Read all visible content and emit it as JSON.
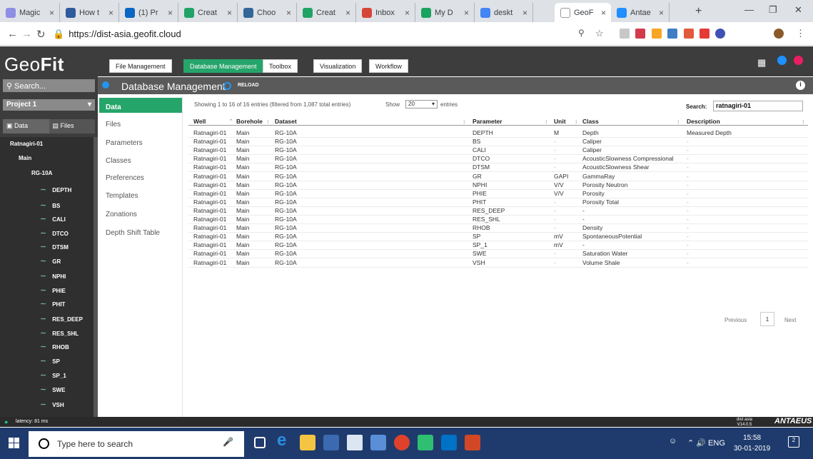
{
  "browser": {
    "tabs": [
      "Magic",
      "How t",
      "(1) Pr",
      "Creat",
      "Choo",
      "Creat",
      "Inbox",
      "My D",
      "deskt",
      "GeoF",
      "Antae"
    ],
    "url": "https://dist-asia.geofit.cloud"
  },
  "app": {
    "logo_light": "Geo",
    "logo_bold": "Fit",
    "search_placeholder": "Search...",
    "project": "Project 1",
    "left_tabs": [
      "Data",
      "Files"
    ],
    "tree": {
      "well": "Ratnagiri-01",
      "borehole": "Main",
      "dataset": "RG-10A",
      "curves": [
        "DEPTH",
        "BS",
        "CALI",
        "DTCO",
        "DTSM",
        "GR",
        "NPHI",
        "PHIE",
        "PHIT",
        "RES_DEEP",
        "RES_SHL",
        "RHOB",
        "SP",
        "SP_1",
        "SWE",
        "VSH"
      ]
    },
    "menu": [
      "File Management",
      "Database Management",
      "Toolbox",
      "Visualization",
      "Workflow"
    ],
    "section_title": "Database Management",
    "reload": "RELOAD",
    "side_menu": [
      "Data",
      "Files",
      "Parameters",
      "Classes",
      "Preferences",
      "Templates",
      "Zonations",
      "Depth Shift Table"
    ],
    "table": {
      "info": "Showing 1 to 16 of 16 entries (filtered from 1,087 total entries)",
      "show_label": "Show",
      "show_value": "20",
      "entries_label": "entries",
      "search_label": "Search:",
      "search_value": "ratnagiri-01",
      "columns": [
        "Well",
        "Borehole",
        "Dataset",
        "Parameter",
        "Unit",
        "Class",
        "Description"
      ],
      "rows": [
        [
          "Ratnagiri-01",
          "Main",
          "RG-10A",
          "DEPTH",
          "M",
          "Depth",
          "Measured Depth"
        ],
        [
          "Ratnagiri-01",
          "Main",
          "RG-10A",
          "BS",
          "-",
          "Caliper",
          "-"
        ],
        [
          "Ratnagiri-01",
          "Main",
          "RG-10A",
          "CALI",
          "-",
          "Caliper",
          "-"
        ],
        [
          "Ratnagiri-01",
          "Main",
          "RG-10A",
          "DTCO",
          "-",
          "AcousticSlowness Compressional",
          "-"
        ],
        [
          "Ratnagiri-01",
          "Main",
          "RG-10A",
          "DTSM",
          "-",
          "AcousticSlowness Shear",
          "-"
        ],
        [
          "Ratnagiri-01",
          "Main",
          "RG-10A",
          "GR",
          "GAPI",
          "GammaRay",
          "-"
        ],
        [
          "Ratnagiri-01",
          "Main",
          "RG-10A",
          "NPHI",
          "V/V",
          "Porosity Neutron",
          "-"
        ],
        [
          "Ratnagiri-01",
          "Main",
          "RG-10A",
          "PHIE",
          "V/V",
          "Porosity",
          "-"
        ],
        [
          "Ratnagiri-01",
          "Main",
          "RG-10A",
          "PHIT",
          "-",
          "Porosity Total",
          "-"
        ],
        [
          "Ratnagiri-01",
          "Main",
          "RG-10A",
          "RES_DEEP",
          "-",
          "-",
          "-"
        ],
        [
          "Ratnagiri-01",
          "Main",
          "RG-10A",
          "RES_SHL",
          "-",
          "-",
          "-"
        ],
        [
          "Ratnagiri-01",
          "Main",
          "RG-10A",
          "RHOB",
          "-",
          "Density",
          "-"
        ],
        [
          "Ratnagiri-01",
          "Main",
          "RG-10A",
          "SP",
          "mV",
          "SpontaneousPotential",
          "-"
        ],
        [
          "Ratnagiri-01",
          "Main",
          "RG-10A",
          "SP_1",
          "mV",
          "-",
          "-"
        ],
        [
          "Ratnagiri-01",
          "Main",
          "RG-10A",
          "SWE",
          "-",
          "Saturation Water",
          "-"
        ],
        [
          "Ratnagiri-01",
          "Main",
          "RG-10A",
          "VSH",
          "-",
          "Volume Shale",
          "-"
        ]
      ],
      "pagination": {
        "previous": "Previous",
        "page": "1",
        "next": "Next"
      }
    },
    "status": {
      "latency": "latency: 81 ms",
      "version_name": "dist asia",
      "version": "V14.0.5",
      "brand": "ANTAEUS"
    }
  },
  "taskbar": {
    "search_placeholder": "Type here to search",
    "lang": "ENG",
    "time": "15:58",
    "date": "30-01-2019",
    "notifications": "2"
  },
  "colors": {
    "accent_green": "#26a56a",
    "sidebar_dark": "#3d3d3d",
    "taskbar_blue": "#1f3b6d"
  }
}
